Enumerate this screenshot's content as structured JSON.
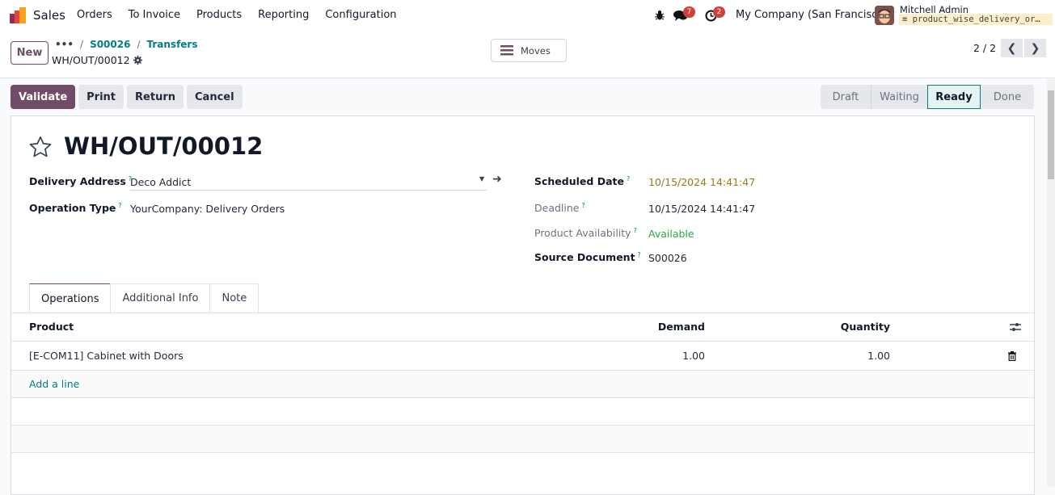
{
  "navbar": {
    "app_name": "Sales",
    "menu": [
      "Orders",
      "To Invoice",
      "Products",
      "Reporting",
      "Configuration"
    ],
    "messages_count": "7",
    "activities_count": "2",
    "company": "My Company (San Francisco)",
    "user_name": "Mitchell Admin",
    "database": "product_wise_delivery_or…"
  },
  "control_panel": {
    "new_label": "New",
    "breadcrumb": {
      "ellipsis": "•••",
      "items": [
        "S00026",
        "Transfers"
      ]
    },
    "record_name": "WH/OUT/00012",
    "moves_label": "Moves",
    "pager": "2 / 2"
  },
  "actions": {
    "validate": "Validate",
    "print": "Print",
    "return": "Return",
    "cancel": "Cancel"
  },
  "status_bar": {
    "states": [
      "Draft",
      "Waiting",
      "Ready",
      "Done"
    ],
    "active": "Ready"
  },
  "form": {
    "title": "WH/OUT/00012",
    "left_fields": [
      {
        "label": "Delivery Address",
        "value": "Deco Addict"
      },
      {
        "label": "Operation Type",
        "value": "YourCompany: Delivery Orders"
      }
    ],
    "right_fields": [
      {
        "label": "Scheduled Date",
        "value": "10/15/2024 14:41:47",
        "color": "#a07515"
      },
      {
        "label": "Deadline",
        "value": "10/15/2024 14:41:47"
      },
      {
        "label": "Product Availability",
        "value": "Available",
        "color": "#28a745"
      },
      {
        "label": "Source Document",
        "value": "S00026"
      }
    ],
    "help_mark": "?"
  },
  "tabs": [
    "Operations",
    "Additional Info",
    "Note"
  ],
  "table": {
    "headers": {
      "product": "Product",
      "demand": "Demand",
      "quantity": "Quantity"
    },
    "rows": [
      {
        "product": "[E-COM11] Cabinet with Doors",
        "demand": "1.00",
        "quantity": "1.00"
      }
    ],
    "add_line": "Add a line"
  },
  "colors": {
    "brand": "#714b67",
    "link": "#017e84"
  }
}
